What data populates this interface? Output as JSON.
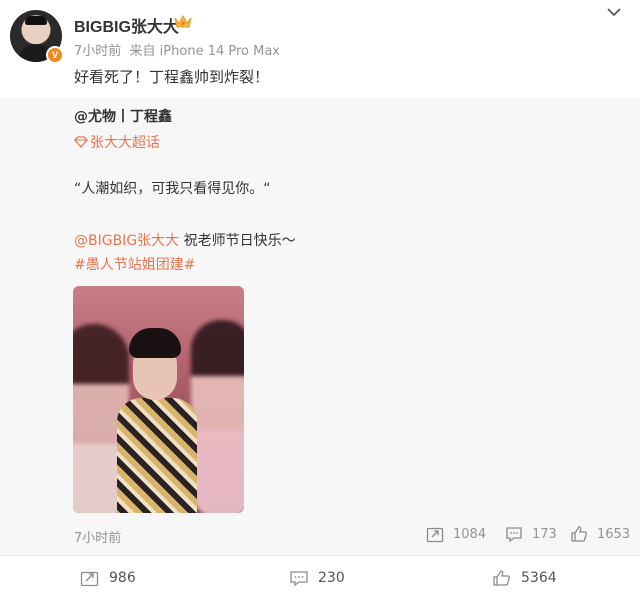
{
  "post": {
    "username": "BIGBIG张大大",
    "time": "7小时前",
    "source": "来自 iPhone 14 Pro Max",
    "text": "好看死了！丁程鑫帅到炸裂！",
    "icons": [
      "crown-icon",
      "verified-badge",
      "chevron-down-icon"
    ]
  },
  "repost": {
    "author": "@尤物丨丁程鑫",
    "supertopic": "张大大超话",
    "quote": "“人潮如织，可我只看得见你。“",
    "mention": "@BIGBIG张大大",
    "greeting": " 祝老师节日快乐～",
    "hashtag": "#愚人节站姐团建#",
    "time": "7小时前",
    "stats": {
      "reposts": "1084",
      "comments": "173",
      "likes": "1653"
    }
  },
  "footer": {
    "reposts": "986",
    "comments": "230",
    "likes": "5364"
  },
  "colors": {
    "link": "#eb7350",
    "muted": "#939393",
    "repost_bg": "#f7f7f7",
    "badge": "#f08a1c"
  }
}
